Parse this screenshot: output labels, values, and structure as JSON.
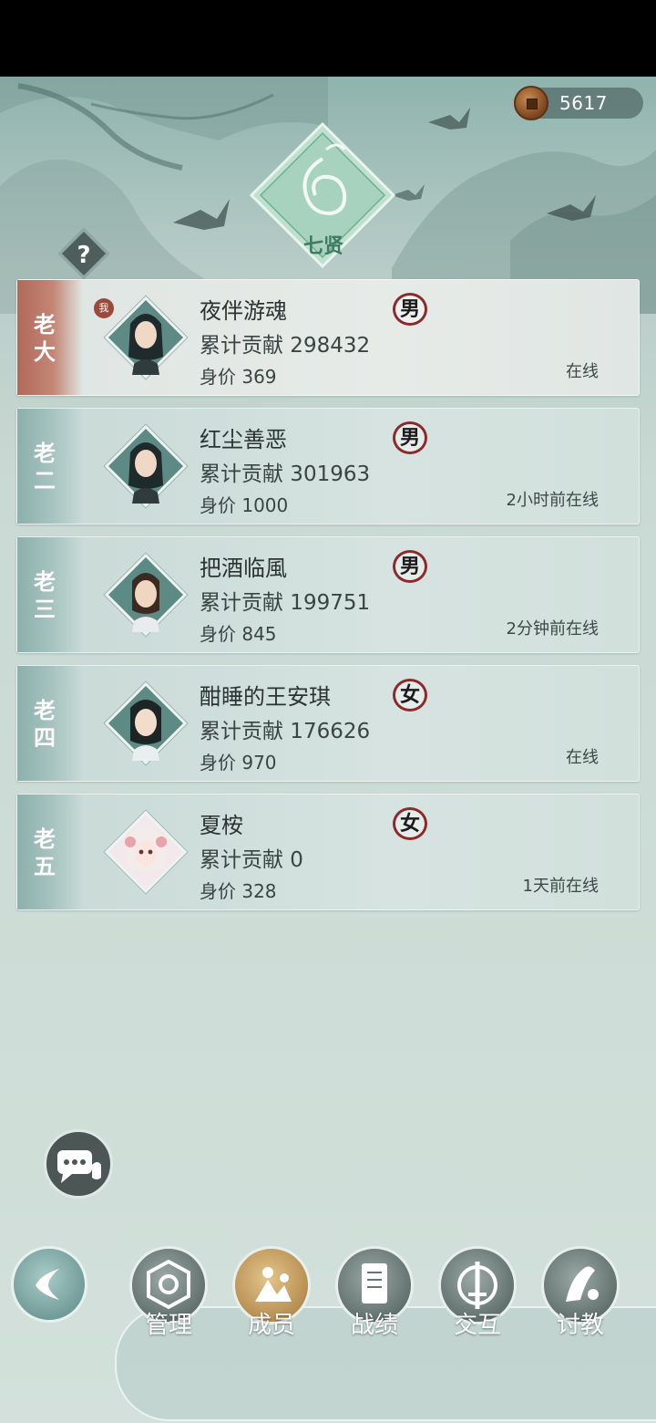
{
  "currency": {
    "icon": "copper-coin-icon",
    "value": "5617"
  },
  "guild": {
    "name": "七贤",
    "help_glyph": "?"
  },
  "members": [
    {
      "rank": "老大",
      "name": "夜伴游魂",
      "contribution": "累计贡献 298432",
      "worth": "身价 369",
      "gender": "男",
      "status": "在线",
      "is_me": true,
      "me_badge": "我"
    },
    {
      "rank": "老二",
      "name": "红尘善恶",
      "contribution": "累计贡献 301963",
      "worth": "身价 1000",
      "gender": "男",
      "status": "2小时前在线",
      "is_me": false
    },
    {
      "rank": "老三",
      "name": "把酒临風",
      "contribution": "累计贡献 199751",
      "worth": "身价 845",
      "gender": "男",
      "status": "2分钟前在线",
      "is_me": false
    },
    {
      "rank": "老四",
      "name": "酣睡的王安琪",
      "contribution": "累计贡献 176626",
      "worth": "身价 970",
      "gender": "女",
      "status": "在线",
      "is_me": false
    },
    {
      "rank": "老五",
      "name": "夏桉",
      "contribution": "累计贡献 0",
      "worth": "身价 328",
      "gender": "女",
      "status": "1天前在线",
      "is_me": false
    }
  ],
  "nav": {
    "back": "back-arrow-icon",
    "items": [
      {
        "label": "管理",
        "icon": "manage-icon",
        "active": false
      },
      {
        "label": "成员",
        "icon": "members-icon",
        "active": true
      },
      {
        "label": "战绩",
        "icon": "scroll-icon",
        "active": false
      },
      {
        "label": "交互",
        "icon": "sword-icon",
        "active": false
      },
      {
        "label": "讨教",
        "icon": "challenge-icon",
        "active": false
      }
    ]
  },
  "colors": {
    "accent_male": "#8c2a2a",
    "first_rank": "#b06a5a",
    "active_nav": "#c9a064"
  }
}
